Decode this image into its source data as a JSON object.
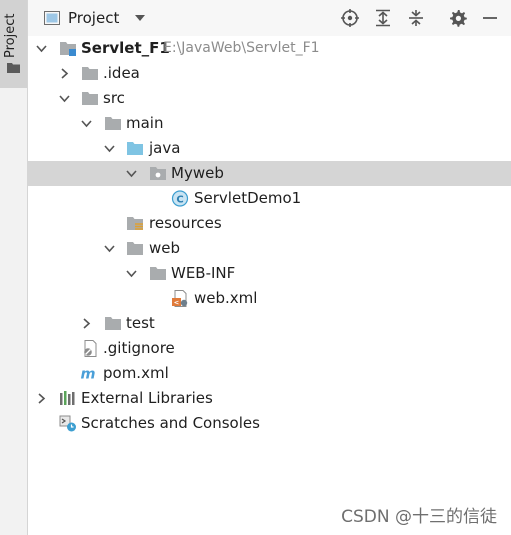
{
  "sidebar": {
    "tab_label": "Project"
  },
  "header": {
    "title": "Project"
  },
  "tree": {
    "root": {
      "label": "Servlet_F1",
      "path": "E:\\JavaWeb\\Servlet_F1"
    },
    "idea": "idea",
    "idea_label": ".idea",
    "src": "src",
    "main": "main",
    "java": "java",
    "myweb": "Myweb",
    "servlet_demo": "ServletDemo1",
    "resources": "resources",
    "web": "web",
    "web_inf": "WEB-INF",
    "web_xml": "web.xml",
    "test": "test",
    "gitignore": ".gitignore",
    "pom": "pom.xml",
    "external_libraries": "External Libraries",
    "scratches": "Scratches and Consoles"
  },
  "watermark": "CSDN @十三的信徒",
  "colors": {
    "folder": "#a9acae",
    "source_folder": "#7fc4e3",
    "selected_row": "#d5d5d5",
    "class_icon": "#3c9ed0"
  }
}
